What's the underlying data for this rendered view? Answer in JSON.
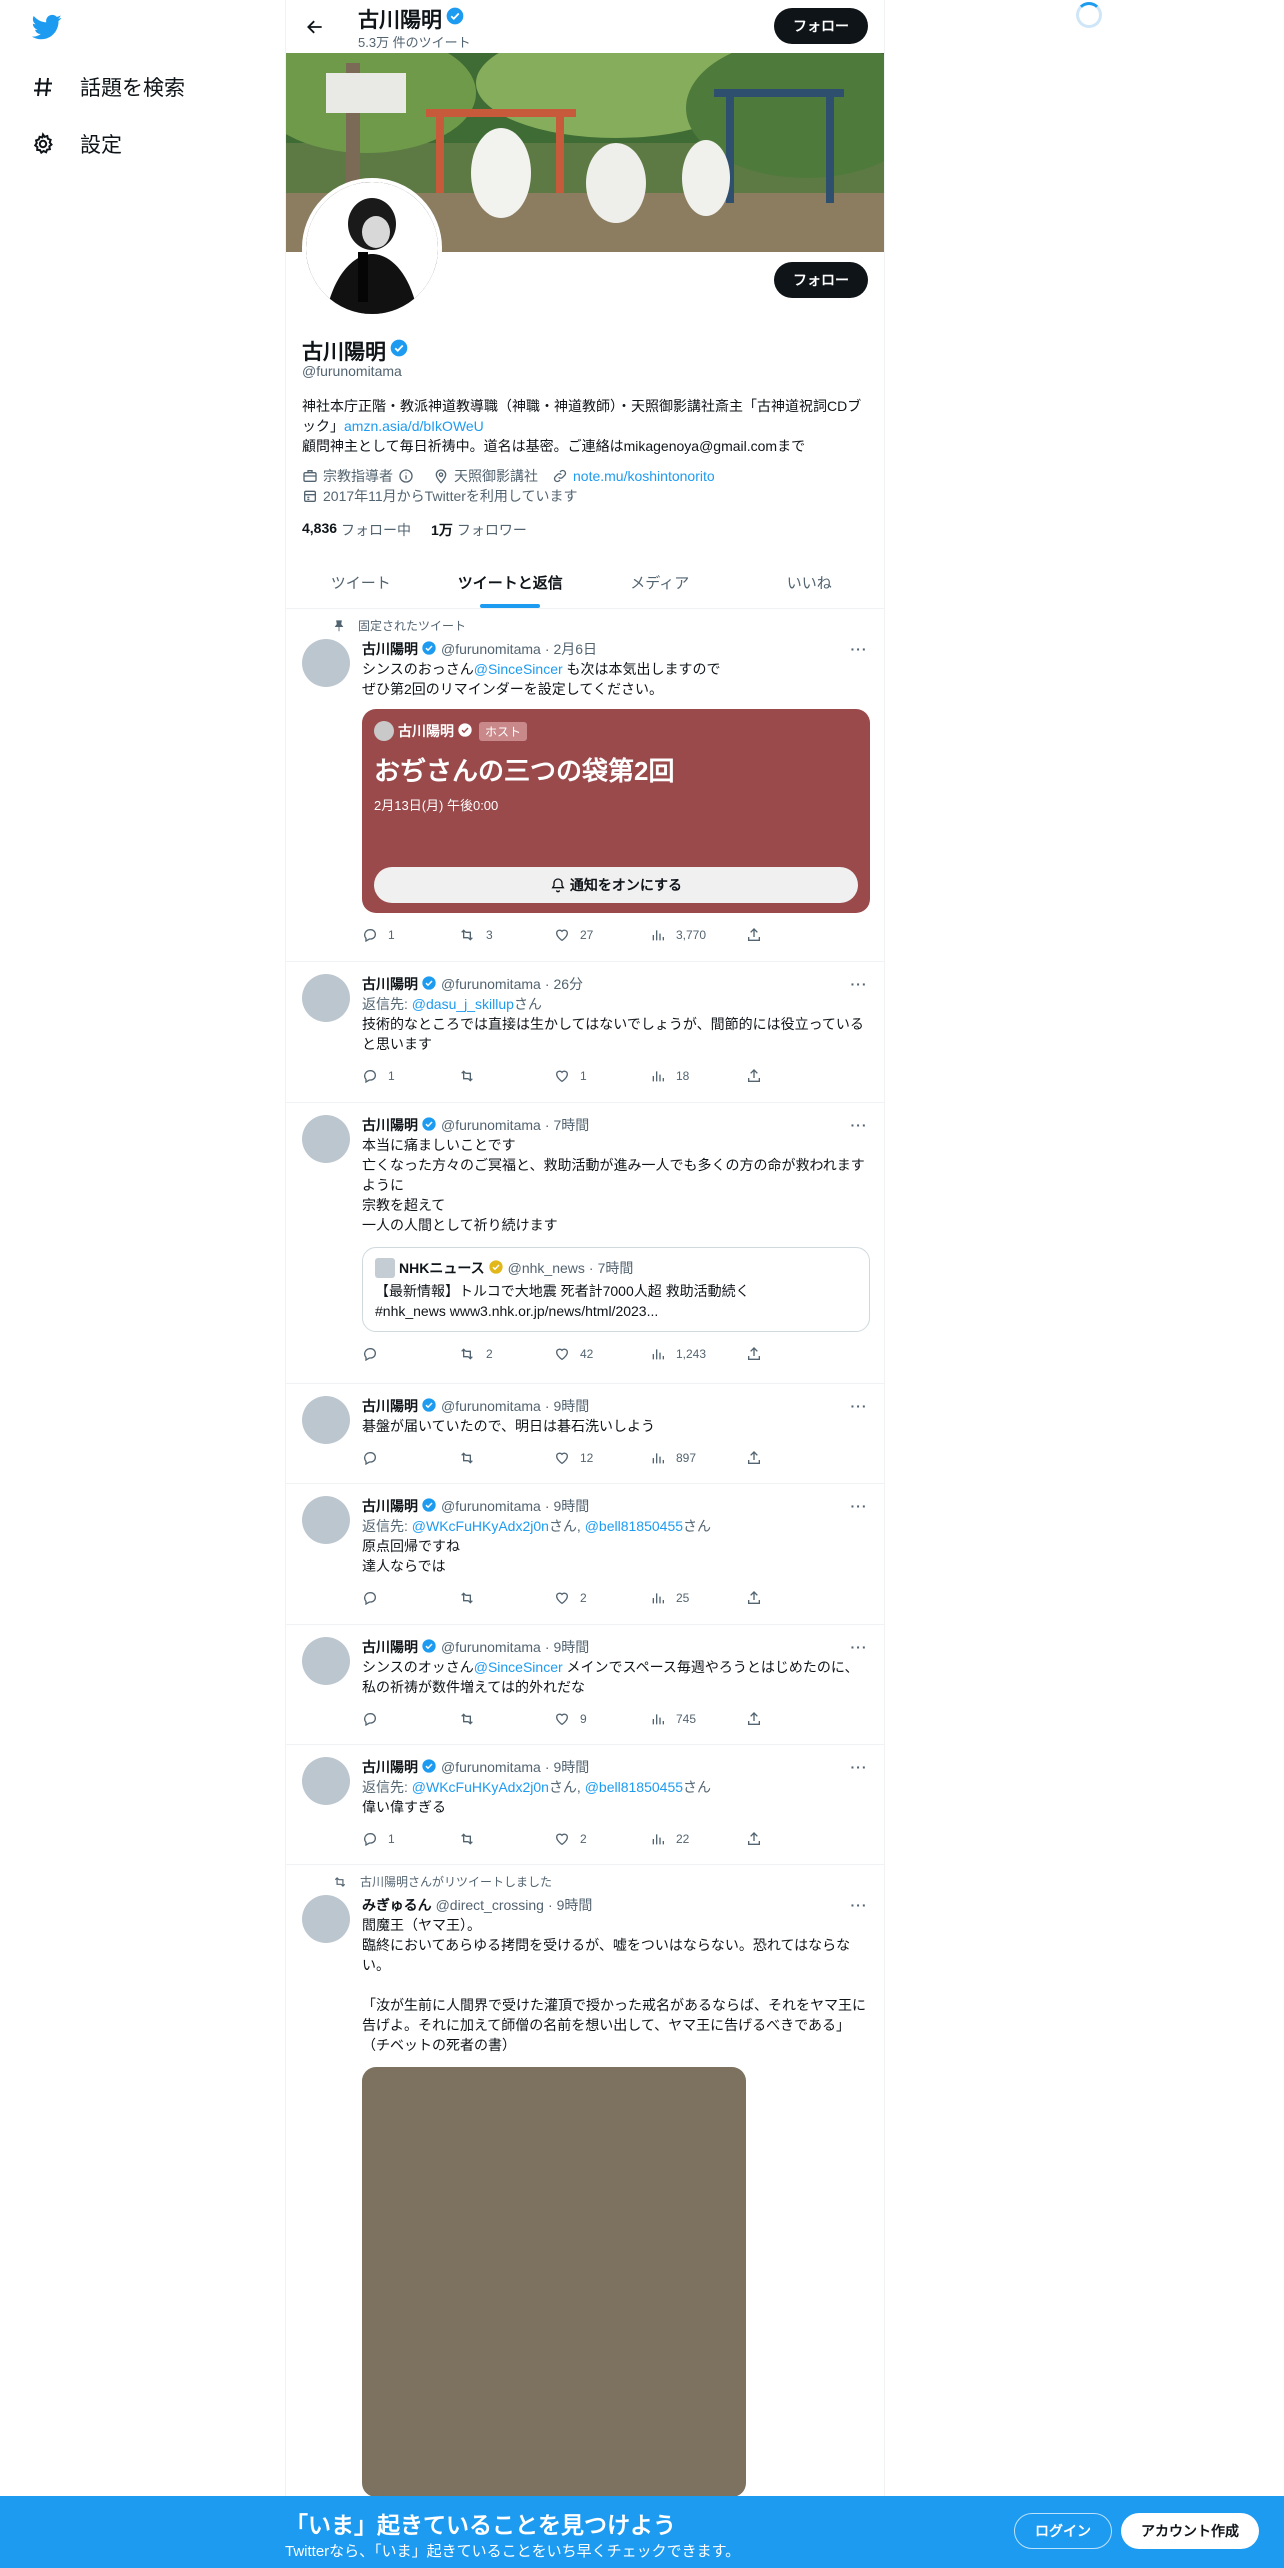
{
  "sidebar": {
    "items": [
      {
        "label": "話題を検索",
        "icon": "hashtag-icon"
      },
      {
        "label": "設定",
        "icon": "gear-icon"
      }
    ]
  },
  "header": {
    "name": "古川陽明",
    "tweet_count": "5.3万 件のツイート",
    "follow_label": "フォロー"
  },
  "profile": {
    "name": "古川陽明",
    "handle": "@furunomitama",
    "follow_label": "フォロー",
    "bio_line1": "神社本庁正階・教派神道教導職（神職・神道教師）・天照御影講社斎主「古神道祝詞CDブック」",
    "bio_link": "amzn.asia/d/bIkOWeU",
    "bio_line2": "顧問神主として毎日祈祷中。道名は基密。ご連絡はmikagenoya@gmail.comまで",
    "category": "宗教指導者",
    "location": "天照御影講社",
    "website": "note.mu/koshintonorito",
    "joined": "2017年11月からTwitterを利用しています",
    "following_count": "4,836",
    "following_label": "フォロー中",
    "followers_count": "1万",
    "followers_label": "フォロワー"
  },
  "tabs": [
    "ツイート",
    "ツイートと返信",
    "メディア",
    "いいね"
  ],
  "pinned_label": "固定されたツイート",
  "tweets": [
    {
      "name": "古川陽明",
      "handle": "@furunomitama",
      "time": "2月6日",
      "text_a": "シンスのおっさん",
      "mention": "@SinceSincer",
      "text_b": " も次は本気出しますので\nぜひ第2回のリマインダーを設定してください。",
      "space": {
        "host": "古川陽明",
        "badge": "ホスト",
        "title": "おぢさんの三つの袋第2回",
        "date": "2月13日(月) 午後0:00",
        "button": "通知をオンにする"
      },
      "replies": "1",
      "retweets": "3",
      "likes": "27",
      "views": "3,770"
    },
    {
      "name": "古川陽明",
      "handle": "@furunomitama",
      "time": "26分",
      "reply_prefix": "返信先: ",
      "reply_to": "@dasu_j_skillup",
      "reply_suffix": "さん",
      "text": "技術的なところでは直接は生かしてはないでしょうが、間節的には役立っていると思います",
      "replies": "1",
      "retweets": "",
      "likes": "1",
      "views": "18"
    },
    {
      "name": "古川陽明",
      "handle": "@furunomitama",
      "time": "7時間",
      "text": "本当に痛ましいことです\n亡くなった方々のご冥福と、救助活動が進み一人でも多くの方の命が救われますように\n宗教を超えて\n一人の人間として祈り続けます",
      "quote": {
        "name": "NHKニュース",
        "handle": "@nhk_news",
        "time": "7時間",
        "text": "【最新情報】トルコで大地震 死者計7000人超 救助活動続く\n#nhk_news www3.nhk.or.jp/news/html/2023..."
      },
      "replies": "",
      "retweets": "2",
      "likes": "42",
      "views": "1,243"
    },
    {
      "name": "古川陽明",
      "handle": "@furunomitama",
      "time": "9時間",
      "text": "碁盤が届いていたので、明日は碁石洗いしよう",
      "replies": "",
      "retweets": "",
      "likes": "12",
      "views": "897"
    },
    {
      "name": "古川陽明",
      "handle": "@furunomitama",
      "time": "9時間",
      "reply_prefix": "返信先: ",
      "reply_to": "@WKcFuHKyAdx2j0n",
      "reply_mid": "さん, ",
      "reply_to2": "@bell81850455",
      "reply_suffix": "さん",
      "text": "原点回帰ですね\n達人ならでは",
      "replies": "",
      "retweets": "",
      "likes": "2",
      "views": "25"
    },
    {
      "name": "古川陽明",
      "handle": "@furunomitama",
      "time": "9時間",
      "text_a": "シンスのオッさん",
      "mention": "@SinceSincer",
      "text_b": " メインでスペース毎週やろうとはじめたのに、私の祈祷が数件増えては的外れだな",
      "replies": "",
      "retweets": "",
      "likes": "9",
      "views": "745"
    },
    {
      "name": "古川陽明",
      "handle": "@furunomitama",
      "time": "9時間",
      "reply_prefix": "返信先: ",
      "reply_to": "@WKcFuHKyAdx2j0n",
      "reply_mid": "さん, ",
      "reply_to2": "@bell81850455",
      "reply_suffix": "さん",
      "text": "偉い偉すぎる",
      "replies": "1",
      "retweets": "",
      "likes": "2",
      "views": "22"
    },
    {
      "retweet_context": "古川陽明さんがリツイートしました",
      "name": "みぎゅるん",
      "handle": "@direct_crossing",
      "time": "9時間",
      "text": "閻魔王（ヤマ王）。\n臨終においてあらゆる拷問を受けるが、嘘をついはならない。恐れてはならない。\n\n「汝が生前に人間界で受けた灌頂で授かった戒名があるならば、それをヤマ王に告げよ。それに加えて師僧の名前を想い出して、ヤマ王に告げるべきである」（チベットの死者の書）"
    }
  ],
  "bottom_bar": {
    "title": "「いま」起きていることを見つけよう",
    "subtitle": "Twitterなら、「いま」起きていることをいち早くチェックできます。",
    "login": "ログイン",
    "signup": "アカウント作成"
  },
  "colors": {
    "accent": "#1d9bf0",
    "space_card": "#9b4a4c",
    "text": "#0f1419",
    "muted": "#536471"
  }
}
